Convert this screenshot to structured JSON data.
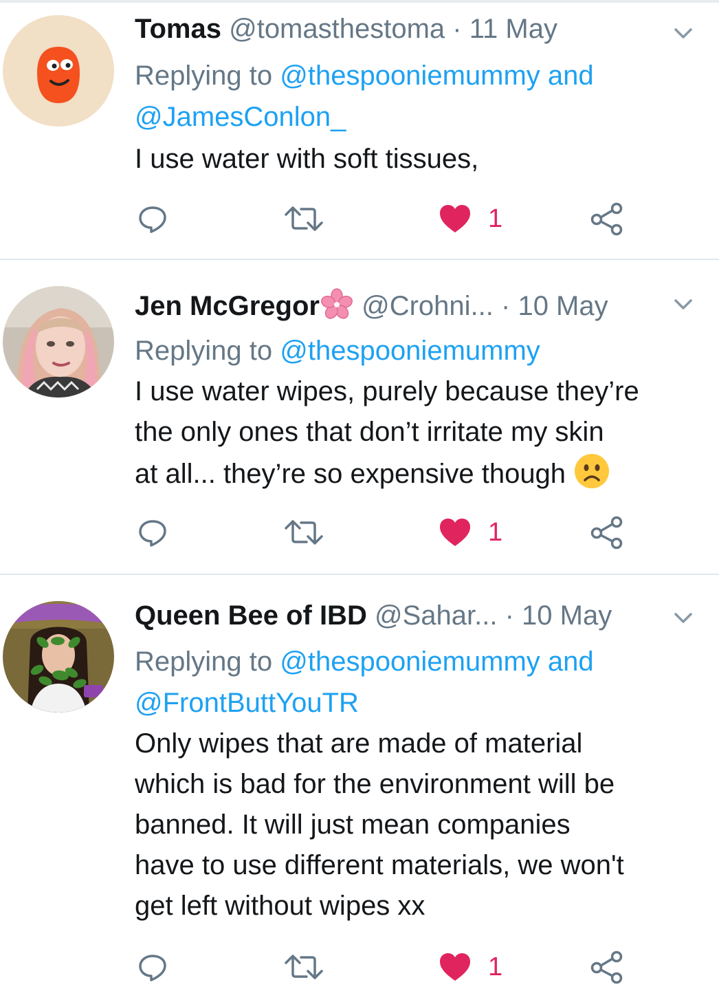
{
  "tweets": [
    {
      "name": "Tomas",
      "handle": "@tomasthestoma",
      "dot": "·",
      "date": "11 May",
      "replying_prefix": "Replying to ",
      "replying_mentions_line1": "@thespooniemummy and",
      "replying_mentions_line2": "@JamesConlon_",
      "lines": [
        "I use water with soft tissues,"
      ],
      "like_count": "1",
      "avatar_icon": "red-blob-character-icon"
    },
    {
      "name": "Jen McGregor",
      "handle": "@Crohni...",
      "dot": "·",
      "date": "10 May",
      "replying_prefix": "Replying to ",
      "replying_mentions_line1": "@thespooniemummy",
      "lines": [
        "I use water wipes, purely because they’re",
        "the only ones that don’t irritate my skin",
        "at all... they’re so expensive though"
      ],
      "like_count": "1",
      "name_emoji": "cherry-blossom-icon",
      "body_emoji": "frowning-face-icon"
    },
    {
      "name": "Queen Bee of IBD",
      "handle": "@Sahar...",
      "dot": "·",
      "date": "10 May",
      "replying_prefix": "Replying to ",
      "replying_mentions_line1": "@thespooniemummy and",
      "replying_mentions_line2": "@FrontButtYouTR",
      "lines": [
        "Only wipes that are made of material",
        "which is bad for the environment will be",
        "banned. It will just mean companies",
        "have to use different materials, we won't",
        "get left without wipes xx"
      ],
      "like_count": "1"
    }
  ],
  "colors": {
    "link": "#1da1f2",
    "muted": "#657786",
    "like": "#e0245e",
    "divider": "#e1e8ed"
  }
}
